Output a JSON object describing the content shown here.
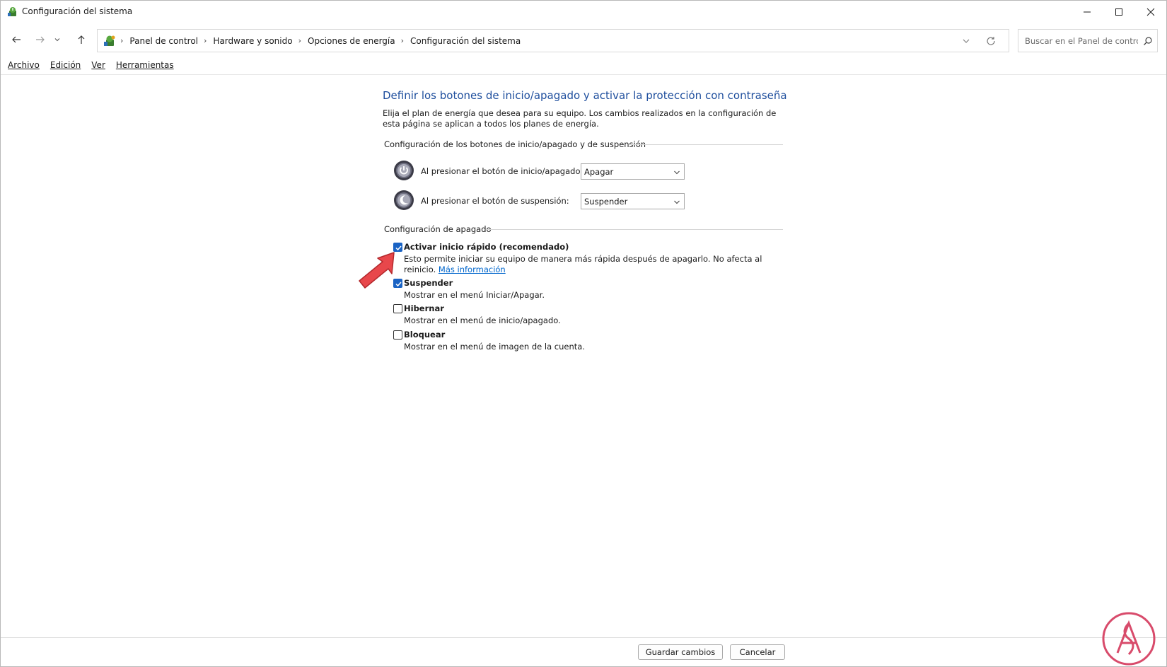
{
  "window": {
    "title": "Configuración del sistema",
    "controls": [
      "minimize-icon",
      "maximize-icon",
      "close-icon"
    ]
  },
  "nav": {
    "back_icon": "arrow-left-icon",
    "forward_icon": "arrow-right-icon",
    "recent_icon": "chevron-down-icon",
    "up_icon": "arrow-up-icon",
    "breadcrumbs": [
      "Panel de control",
      "Hardware y sonido",
      "Opciones de energía",
      "Configuración del sistema"
    ],
    "search_placeholder": "Buscar en el Panel de control"
  },
  "menu": {
    "items": [
      "Archivo",
      "Edición",
      "Ver",
      "Herramientas"
    ]
  },
  "main": {
    "heading": "Definir los botones de inicio/apagado y activar la protección con contraseña",
    "description": "Elija el plan de energía que desea para su equipo. Los cambios realizados en la configuración de esta página se aplican a todos los planes de energía.",
    "buttons_group": {
      "title": "Configuración de los botones de inicio/apagado y de suspensión",
      "power_button": {
        "label": "Al presionar el botón de inicio/apagado:",
        "value": "Apagar"
      },
      "sleep_button": {
        "label": "Al presionar el botón de suspensión:",
        "value": "Suspender"
      }
    },
    "shutdown_group": {
      "title": "Configuración de apagado",
      "options": [
        {
          "label": "Activar inicio rápido (recomendado)",
          "checked": true,
          "description": "Esto permite iniciar su equipo de manera más rápida después de apagarlo. No afecta al reinicio. ",
          "link": "Más información"
        },
        {
          "label": "Suspender",
          "checked": true,
          "description": "Mostrar en el menú Iniciar/Apagar."
        },
        {
          "label": "Hibernar",
          "checked": false,
          "description": "Mostrar en el menú de inicio/apagado."
        },
        {
          "label": "Bloquear",
          "checked": false,
          "description": "Mostrar en el menú de imagen de la cuenta."
        }
      ]
    }
  },
  "footer": {
    "save_label": "Guardar cambios",
    "cancel_label": "Cancelar"
  },
  "colors": {
    "heading": "#1e4e9d",
    "checkbox_checked": "#1a63c4",
    "link": "#0066cc",
    "arrow": "#e8474b"
  }
}
